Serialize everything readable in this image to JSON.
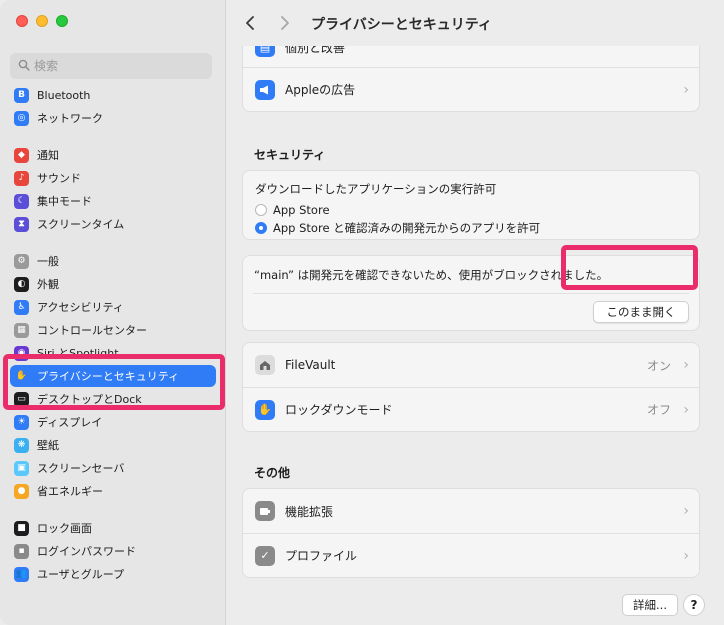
{
  "window": {
    "title": "プライバシーとセキュリティ"
  },
  "search": {
    "placeholder": "検索"
  },
  "sidebar": {
    "items": [
      {
        "label": "Bluetooth",
        "icon": "bluetooth-icon",
        "color": "#2f7cf6",
        "glyph": "B"
      },
      {
        "label": "ネットワーク",
        "icon": "network-icon",
        "color": "#2f7cf6",
        "glyph": "◎"
      },
      {
        "label": "通知",
        "icon": "bell-icon",
        "color": "#e8453c",
        "glyph": "◆"
      },
      {
        "label": "サウンド",
        "icon": "sound-icon",
        "color": "#e8453c",
        "glyph": "♪"
      },
      {
        "label": "集中モード",
        "icon": "moon-icon",
        "color": "#5a4fd6",
        "glyph": "☾"
      },
      {
        "label": "スクリーンタイム",
        "icon": "hourglass-icon",
        "color": "#5a4fd6",
        "glyph": "⧗"
      },
      {
        "label": "一般",
        "icon": "gear-icon",
        "color": "#9a9a9a",
        "glyph": "⚙"
      },
      {
        "label": "外観",
        "icon": "appearance-icon",
        "color": "#1d1d1f",
        "glyph": "◐"
      },
      {
        "label": "アクセシビリティ",
        "icon": "accessibility-icon",
        "color": "#2f7cf6",
        "glyph": "♿"
      },
      {
        "label": "コントロールセンター",
        "icon": "control-center-icon",
        "color": "#9a9a9a",
        "glyph": "▦"
      },
      {
        "label": "Siri とSpotlight",
        "icon": "siri-icon",
        "color": "#6a3ad0",
        "glyph": "◉"
      },
      {
        "label": "プライバシーとセキュリティ",
        "icon": "hand-icon",
        "color": "#2f7cf6",
        "glyph": "✋",
        "active": true
      },
      {
        "label": "デスクトップとDock",
        "icon": "desktop-icon",
        "color": "#1d1d1f",
        "glyph": "▭"
      },
      {
        "label": "ディスプレイ",
        "icon": "display-icon",
        "color": "#2f7cf6",
        "glyph": "☀"
      },
      {
        "label": "壁紙",
        "icon": "wallpaper-icon",
        "color": "#3ab0f0",
        "glyph": "❋"
      },
      {
        "label": "スクリーンセーバ",
        "icon": "screensaver-icon",
        "color": "#5ac8fa",
        "glyph": "▣"
      },
      {
        "label": "省エネルギー",
        "icon": "battery-icon",
        "color": "#f5a623",
        "glyph": "●"
      },
      {
        "label": "ロック画面",
        "icon": "lock-screen-icon",
        "color": "#1d1d1f",
        "glyph": "■"
      },
      {
        "label": "ログインパスワード",
        "icon": "password-icon",
        "color": "#8a8a8a",
        "glyph": "▪"
      },
      {
        "label": "ユーザとグループ",
        "icon": "users-icon",
        "color": "#2f7cf6",
        "glyph": "👥"
      }
    ]
  },
  "main": {
    "top_partial_label": "個別と改善",
    "apple_ads_label": "Appleの広告",
    "security_header": "セキュリティ",
    "download_title": "ダウンロードしたアプリケーションの実行許可",
    "radio_app_store": "App Store",
    "radio_app_store_dev": "App Store と確認済みの開発元からのアプリを許可",
    "blocked_message": "“main” は開発元を確認できないため、使用がブロックされました。",
    "open_anyway": "このまま開く",
    "filevault_label": "FileVault",
    "filevault_value": "オン",
    "lockdown_label": "ロックダウンモード",
    "lockdown_value": "オフ",
    "other_header": "その他",
    "extensions_label": "機能拡張",
    "profiles_label": "プロファイル",
    "detail_button": "詳細...",
    "help_button": "?"
  }
}
